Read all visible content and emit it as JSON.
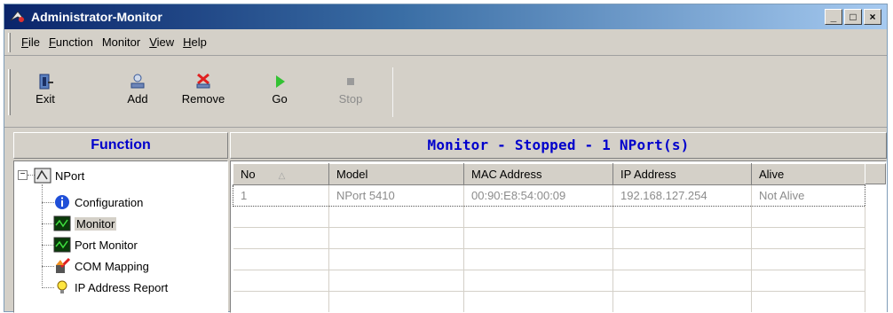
{
  "window": {
    "title": "Administrator-Monitor"
  },
  "window_controls": {
    "minimize": "_",
    "maximize": "□",
    "close": "×"
  },
  "menu": {
    "items": [
      {
        "underline": "F",
        "rest": "ile"
      },
      {
        "underline": "F",
        "rest": "unction"
      },
      {
        "underline": "",
        "rest": "Monitor"
      },
      {
        "underline": "V",
        "rest": "iew"
      },
      {
        "underline": "H",
        "rest": "elp"
      }
    ]
  },
  "toolbar": {
    "exit": "Exit",
    "add": "Add",
    "remove": "Remove",
    "go": "Go",
    "stop": "Stop"
  },
  "left_panel": {
    "header": "Function",
    "tree": {
      "root": "NPort",
      "children": [
        "Configuration",
        "Monitor",
        "Port Monitor",
        "COM Mapping",
        "IP Address Report"
      ],
      "selected": "Monitor"
    }
  },
  "right_panel": {
    "header": "Monitor - Stopped - 1 NPort(s)",
    "columns": [
      "No",
      "Model",
      "MAC Address",
      "IP Address",
      "Alive"
    ],
    "sort_indicator": "△",
    "rows": [
      {
        "no": "1",
        "model": "NPort 5410",
        "mac": "00:90:E8:54:00:09",
        "ip": "192.168.127.254",
        "alive": "Not Alive"
      }
    ]
  },
  "colors": {
    "accent_text": "#0000cc",
    "title_bar_start": "#0a246a",
    "title_bar_end": "#a6caf0",
    "face": "#d4d0c8"
  }
}
